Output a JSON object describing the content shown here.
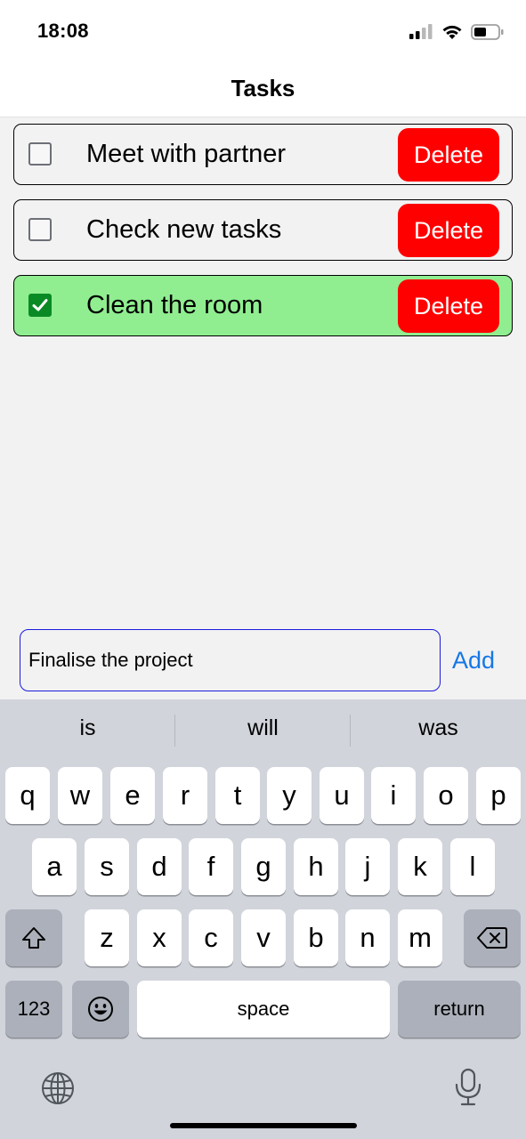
{
  "status_bar": {
    "time": "18:08"
  },
  "header": {
    "title": "Tasks"
  },
  "tasks": [
    {
      "label": "Meet with partner",
      "done": false,
      "delete_label": "Delete"
    },
    {
      "label": "Check new tasks",
      "done": false,
      "delete_label": "Delete"
    },
    {
      "label": "Clean the room",
      "done": true,
      "delete_label": "Delete"
    }
  ],
  "input": {
    "value": "Finalise the project",
    "add_label": "Add"
  },
  "keyboard": {
    "suggestions": [
      "is",
      "will",
      "was"
    ],
    "row1": [
      "q",
      "w",
      "e",
      "r",
      "t",
      "y",
      "u",
      "i",
      "o",
      "p"
    ],
    "row2": [
      "a",
      "s",
      "d",
      "f",
      "g",
      "h",
      "j",
      "k",
      "l"
    ],
    "row3": [
      "z",
      "x",
      "c",
      "v",
      "b",
      "n",
      "m"
    ],
    "numbers_label": "123",
    "space_label": "space",
    "return_label": "return"
  },
  "colors": {
    "done_background": "#90ee90",
    "delete_button": "#ff0000",
    "add_link": "#1677e6",
    "input_border": "#1a1adc",
    "checkbox_checked": "#0a8a24"
  },
  "icons": [
    "signal-icon",
    "wifi-icon",
    "battery-icon",
    "checkmark-icon",
    "shift-icon",
    "backspace-icon",
    "emoji-icon",
    "globe-icon",
    "microphone-icon"
  ]
}
